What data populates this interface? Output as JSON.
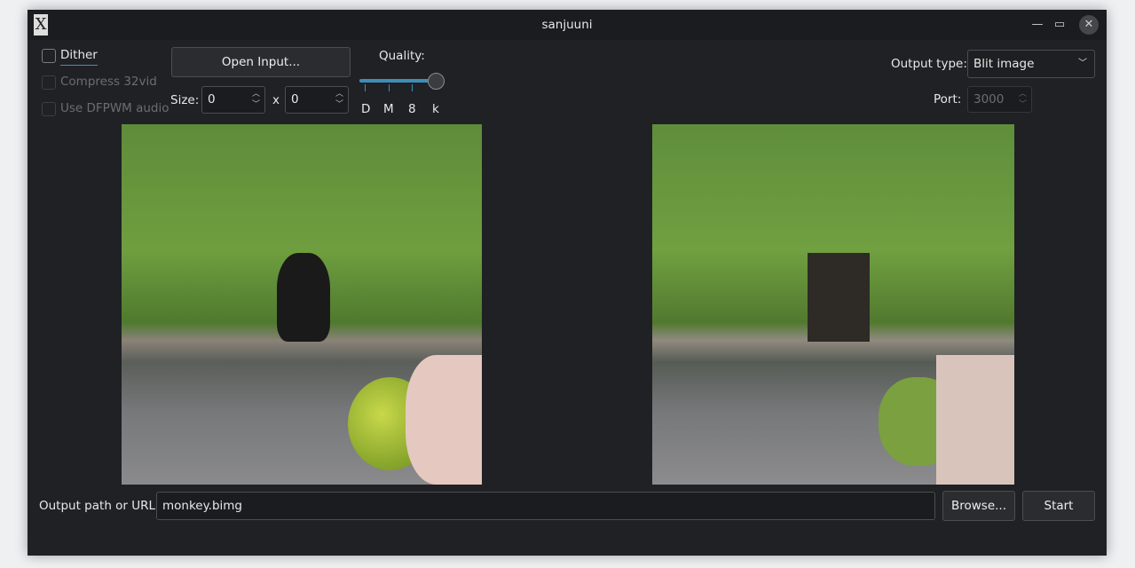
{
  "window": {
    "title": "sanjuuni"
  },
  "options": {
    "dither": {
      "label": "Dither",
      "checked": false
    },
    "compress": {
      "label": "Compress 32vid",
      "checked": false,
      "disabled": true
    },
    "dfpwm": {
      "label": "Use DFPWM audio",
      "checked": false,
      "disabled": true
    }
  },
  "open_input_label": "Open Input...",
  "size": {
    "label": "Size:",
    "width": "0",
    "separator": "x",
    "height": "0"
  },
  "quality": {
    "label": "Quality:",
    "ticks": [
      "D",
      "M",
      "8",
      "k"
    ],
    "selected_index": 3
  },
  "output_type": {
    "label": "Output type:",
    "value": "Blit image"
  },
  "port": {
    "label": "Port:",
    "value": "3000",
    "disabled": true
  },
  "output_path": {
    "label": "Output path or URL:",
    "value": "monkey.bimg"
  },
  "browse_label": "Browse...",
  "start_label": "Start",
  "colors": {
    "accent": "#3d8fb8",
    "window_bg": "#202124"
  }
}
